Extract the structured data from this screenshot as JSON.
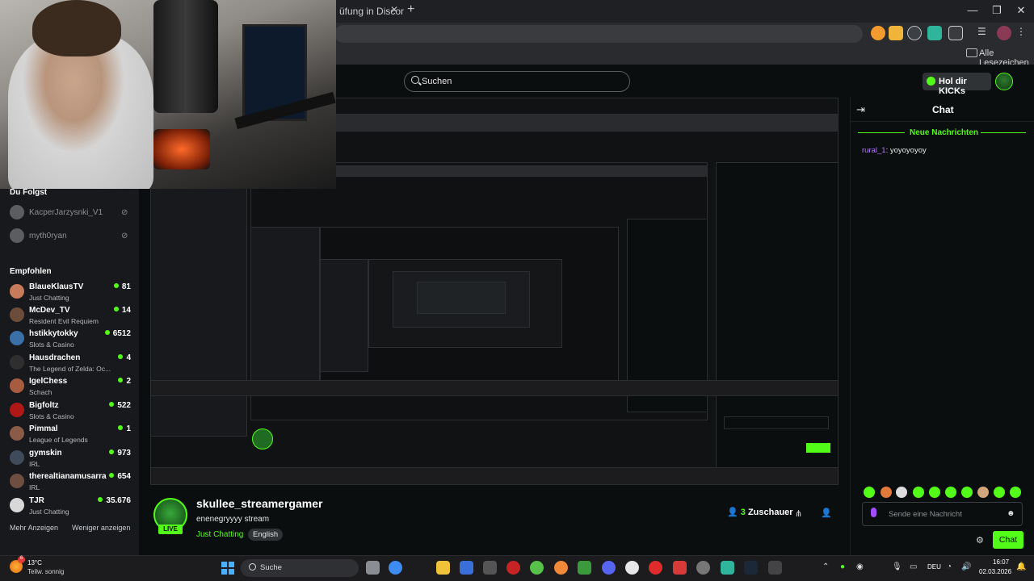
{
  "browser": {
    "tab_title": "üfung in Discord",
    "new_tab": "+",
    "bookmarks_label": "Alle Lesezeichen",
    "window_controls": [
      "—",
      "❐",
      "✕"
    ]
  },
  "header": {
    "search_placeholder": "Suchen",
    "hol_dir_kicks": "Hol dir KICKs"
  },
  "sidebar": {
    "following_heading": "Du Folgst",
    "following": [
      {
        "name": "KacperJarzysnki_V1"
      },
      {
        "name": "myth0ryan"
      }
    ],
    "recommended_heading": "Empfohlen",
    "recommended": [
      {
        "name": "BlaueKlausTV",
        "category": "Just Chatting",
        "viewers": "81",
        "color": "#c77b5a"
      },
      {
        "name": "McDev_TV",
        "category": "Resident Evil Requiem",
        "viewers": "14",
        "color": "#6b4d3a"
      },
      {
        "name": "hstikkytokky",
        "category": "Slots & Casino",
        "viewers": "6512",
        "color": "#3a6fa8"
      },
      {
        "name": "Hausdrachen",
        "category": "The Legend of Zelda: Oc...",
        "viewers": "4",
        "color": "#2f2f2f"
      },
      {
        "name": "IgelChess",
        "category": "Schach",
        "viewers": "2",
        "color": "#a85c3f"
      },
      {
        "name": "Bigfoltz",
        "category": "Slots & Casino",
        "viewers": "522",
        "color": "#b01818"
      },
      {
        "name": "Pimmal",
        "category": "League of Legends",
        "viewers": "1",
        "color": "#8a5b47"
      },
      {
        "name": "gymskin",
        "category": "IRL",
        "viewers": "973",
        "color": "#3f4a5a"
      },
      {
        "name": "therealtianamusarra",
        "category": "IRL",
        "viewers": "654",
        "color": "#6d4e41"
      },
      {
        "name": "TJR",
        "category": "Just Chatting",
        "viewers": "35.676",
        "color": "#d8d8d8"
      }
    ],
    "show_more": "Mehr Anzeigen",
    "show_less": "Weniger anzeigen"
  },
  "stream": {
    "channel": "skullee_streamergamer",
    "title": "enenegryyyy stream",
    "category": "Just Chatting",
    "language": "English",
    "live": "LIVE",
    "viewers_count": "3",
    "viewers_label": "Zuschauer"
  },
  "chat": {
    "title": "Chat",
    "new_messages": "Neue Nachrichten",
    "messages": [
      {
        "user": "rural_1",
        "text": "yoyoyoyoy"
      }
    ],
    "input_placeholder": "Sende eine Nachricht",
    "send_label": "Chat"
  },
  "taskbar": {
    "weather_temp": "13°C",
    "weather_desc": "Teilw. sonnig",
    "weather_badge": "6",
    "search_label": "Suche",
    "lang": "DEU",
    "time": "16:07",
    "date": "02.03.2026"
  },
  "colors": {
    "accent": "#53fc18",
    "background": "#0b0e0f",
    "sidebar": "#18191c"
  }
}
